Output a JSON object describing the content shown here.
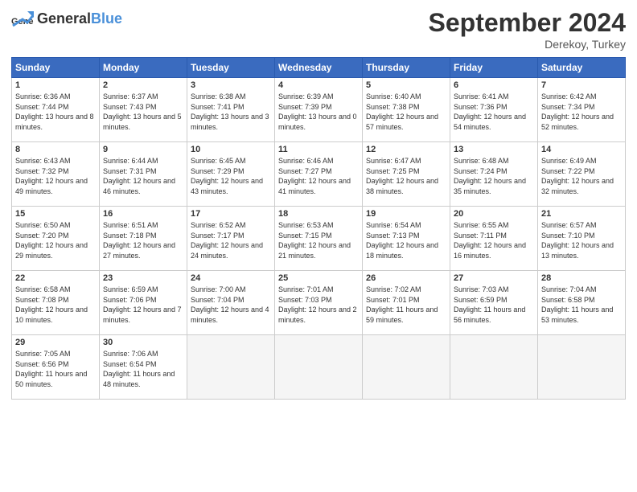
{
  "header": {
    "logo_general": "General",
    "logo_blue": "Blue",
    "title": "September 2024",
    "location": "Derekoy, Turkey"
  },
  "days_of_week": [
    "Sunday",
    "Monday",
    "Tuesday",
    "Wednesday",
    "Thursday",
    "Friday",
    "Saturday"
  ],
  "weeks": [
    [
      {
        "day": "1",
        "sunrise": "6:36 AM",
        "sunset": "7:44 PM",
        "daylight": "13 hours and 8 minutes."
      },
      {
        "day": "2",
        "sunrise": "6:37 AM",
        "sunset": "7:43 PM",
        "daylight": "13 hours and 5 minutes."
      },
      {
        "day": "3",
        "sunrise": "6:38 AM",
        "sunset": "7:41 PM",
        "daylight": "13 hours and 3 minutes."
      },
      {
        "day": "4",
        "sunrise": "6:39 AM",
        "sunset": "7:39 PM",
        "daylight": "13 hours and 0 minutes."
      },
      {
        "day": "5",
        "sunrise": "6:40 AM",
        "sunset": "7:38 PM",
        "daylight": "12 hours and 57 minutes."
      },
      {
        "day": "6",
        "sunrise": "6:41 AM",
        "sunset": "7:36 PM",
        "daylight": "12 hours and 54 minutes."
      },
      {
        "day": "7",
        "sunrise": "6:42 AM",
        "sunset": "7:34 PM",
        "daylight": "12 hours and 52 minutes."
      }
    ],
    [
      {
        "day": "8",
        "sunrise": "6:43 AM",
        "sunset": "7:32 PM",
        "daylight": "12 hours and 49 minutes."
      },
      {
        "day": "9",
        "sunrise": "6:44 AM",
        "sunset": "7:31 PM",
        "daylight": "12 hours and 46 minutes."
      },
      {
        "day": "10",
        "sunrise": "6:45 AM",
        "sunset": "7:29 PM",
        "daylight": "12 hours and 43 minutes."
      },
      {
        "day": "11",
        "sunrise": "6:46 AM",
        "sunset": "7:27 PM",
        "daylight": "12 hours and 41 minutes."
      },
      {
        "day": "12",
        "sunrise": "6:47 AM",
        "sunset": "7:25 PM",
        "daylight": "12 hours and 38 minutes."
      },
      {
        "day": "13",
        "sunrise": "6:48 AM",
        "sunset": "7:24 PM",
        "daylight": "12 hours and 35 minutes."
      },
      {
        "day": "14",
        "sunrise": "6:49 AM",
        "sunset": "7:22 PM",
        "daylight": "12 hours and 32 minutes."
      }
    ],
    [
      {
        "day": "15",
        "sunrise": "6:50 AM",
        "sunset": "7:20 PM",
        "daylight": "12 hours and 29 minutes."
      },
      {
        "day": "16",
        "sunrise": "6:51 AM",
        "sunset": "7:18 PM",
        "daylight": "12 hours and 27 minutes."
      },
      {
        "day": "17",
        "sunrise": "6:52 AM",
        "sunset": "7:17 PM",
        "daylight": "12 hours and 24 minutes."
      },
      {
        "day": "18",
        "sunrise": "6:53 AM",
        "sunset": "7:15 PM",
        "daylight": "12 hours and 21 minutes."
      },
      {
        "day": "19",
        "sunrise": "6:54 AM",
        "sunset": "7:13 PM",
        "daylight": "12 hours and 18 minutes."
      },
      {
        "day": "20",
        "sunrise": "6:55 AM",
        "sunset": "7:11 PM",
        "daylight": "12 hours and 16 minutes."
      },
      {
        "day": "21",
        "sunrise": "6:57 AM",
        "sunset": "7:10 PM",
        "daylight": "12 hours and 13 minutes."
      }
    ],
    [
      {
        "day": "22",
        "sunrise": "6:58 AM",
        "sunset": "7:08 PM",
        "daylight": "12 hours and 10 minutes."
      },
      {
        "day": "23",
        "sunrise": "6:59 AM",
        "sunset": "7:06 PM",
        "daylight": "12 hours and 7 minutes."
      },
      {
        "day": "24",
        "sunrise": "7:00 AM",
        "sunset": "7:04 PM",
        "daylight": "12 hours and 4 minutes."
      },
      {
        "day": "25",
        "sunrise": "7:01 AM",
        "sunset": "7:03 PM",
        "daylight": "12 hours and 2 minutes."
      },
      {
        "day": "26",
        "sunrise": "7:02 AM",
        "sunset": "7:01 PM",
        "daylight": "11 hours and 59 minutes."
      },
      {
        "day": "27",
        "sunrise": "7:03 AM",
        "sunset": "6:59 PM",
        "daylight": "11 hours and 56 minutes."
      },
      {
        "day": "28",
        "sunrise": "7:04 AM",
        "sunset": "6:58 PM",
        "daylight": "11 hours and 53 minutes."
      }
    ],
    [
      {
        "day": "29",
        "sunrise": "7:05 AM",
        "sunset": "6:56 PM",
        "daylight": "11 hours and 50 minutes."
      },
      {
        "day": "30",
        "sunrise": "7:06 AM",
        "sunset": "6:54 PM",
        "daylight": "11 hours and 48 minutes."
      },
      null,
      null,
      null,
      null,
      null
    ]
  ]
}
